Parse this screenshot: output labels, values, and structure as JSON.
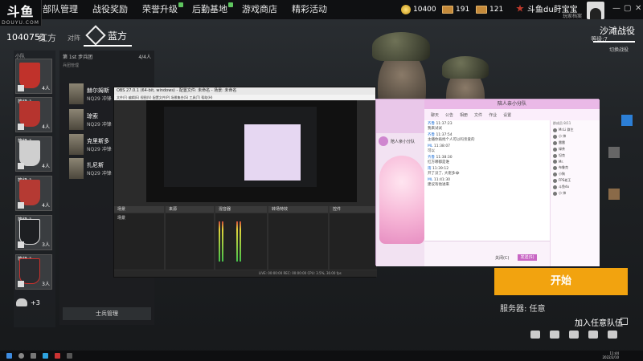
{
  "logo": {
    "main": "斗鱼",
    "sub": "DOUYU.COM"
  },
  "nav": [
    {
      "label": "部队管理",
      "badge": false
    },
    {
      "label": "战役奖励",
      "badge": false
    },
    {
      "label": "荣誉升级",
      "badge": true
    },
    {
      "label": "后勤基地",
      "badge": true
    },
    {
      "label": "游戏商店",
      "badge": false
    },
    {
      "label": "精彩活动",
      "badge": false
    }
  ],
  "currency": {
    "silver": "10400",
    "cards_a": "191",
    "cards_b": "121"
  },
  "player": {
    "name": "斗鱼du莳宝宝",
    "sub": "玩家档案"
  },
  "window_controls": [
    "—",
    "▢",
    "✕"
  ],
  "room": {
    "id": "1040751",
    "red_label": "红方",
    "vs_label": "对阵",
    "blue_label": "蓝方"
  },
  "map": {
    "title": "沙滩战役",
    "level": "等级:7",
    "switch": "切换战役"
  },
  "squads_col": {
    "header": "小队",
    "cards": [
      {
        "level": "",
        "count": "4人",
        "color": "#c0322b"
      },
      {
        "level": "等级:1",
        "count": "4人",
        "color": "#b6342e"
      },
      {
        "level": "等级:1",
        "count": "4人",
        "color": "#cfcfcf"
      },
      {
        "level": "等级:1",
        "count": "4人",
        "color": "#b53a33"
      },
      {
        "level": "等级:1",
        "count": "3人",
        "color": "#1d1f22"
      },
      {
        "level": "等级:1",
        "count": "3人",
        "color": "#2b2c30"
      }
    ],
    "more": "+3"
  },
  "squad_panel": {
    "title": "第 1st 步兵团",
    "size": "4/4人",
    "section": "兵团管理",
    "members": [
      {
        "name": "赫尔姆斯",
        "gun": "NQ29 冲锋"
      },
      {
        "name": "琼索",
        "gun": "NQ29 冲锋"
      },
      {
        "name": "克里斯多",
        "gun": "NQ29 冲锋"
      },
      {
        "name": "扎尼斯",
        "gun": "NQ29 冲锋"
      }
    ],
    "manage_label": "士兵管理"
  },
  "obs": {
    "title": "OBS 27.0.1 (64-bit, windows) - 配置文件: 未命名 - 场景: 未命名",
    "menu": "文件(F)  编辑(E)  视图(V)  配置文件(P)  场景集合(S)  工具(T)  帮助(H)",
    "docks": [
      "场景",
      "来源",
      "混音器",
      "转场特效",
      "控件"
    ],
    "scene_item": "场景",
    "status": "LIVE: 00:00:00   REC: 00:00:00   CPU: 3.5%, 30.00 fps"
  },
  "qq": {
    "title": "陪人亲小分队",
    "toolbar": [
      "聊天",
      "公告",
      "相册",
      "文件",
      "作业",
      "设置"
    ],
    "contact": "陪人亲小分队",
    "messages": [
      {
        "name": "齐鲁",
        "time": "11:37:23",
        "text": "我来试试"
      },
      {
        "name": "齐鲁",
        "time": "11:37:54",
        "text": "主播你再找个人可以吗亲爱的"
      },
      {
        "name": "ML",
        "time": "11:38:07",
        "text": "可以"
      },
      {
        "name": "齐鲁",
        "time": "11:38:30",
        "text": "红方哪都是谁"
      },
      {
        "name": "雨",
        "time": "11:39:12",
        "text": "开了没了, 大佬多😂"
      },
      {
        "name": "ML",
        "time": "11:41:30",
        "text": "建议有他进来"
      }
    ],
    "close_btn": "关闭(C)",
    "send_btn": "发送(S)",
    "members_title": "群成员 8/11",
    "members": [
      "Mr.Li 群主",
      "小 帅",
      "雷雷",
      "绿茶",
      "坦克",
      "Mr.",
      "布鲁克",
      "小狗",
      "FPS老王",
      "斗鱼du",
      "小 帅"
    ]
  },
  "start_label": "开始",
  "server_label": "服务器: 任意",
  "join_queue_label": "加入任意队伍",
  "taskbar": {
    "time": "11:44",
    "date": "2022/2/10"
  }
}
